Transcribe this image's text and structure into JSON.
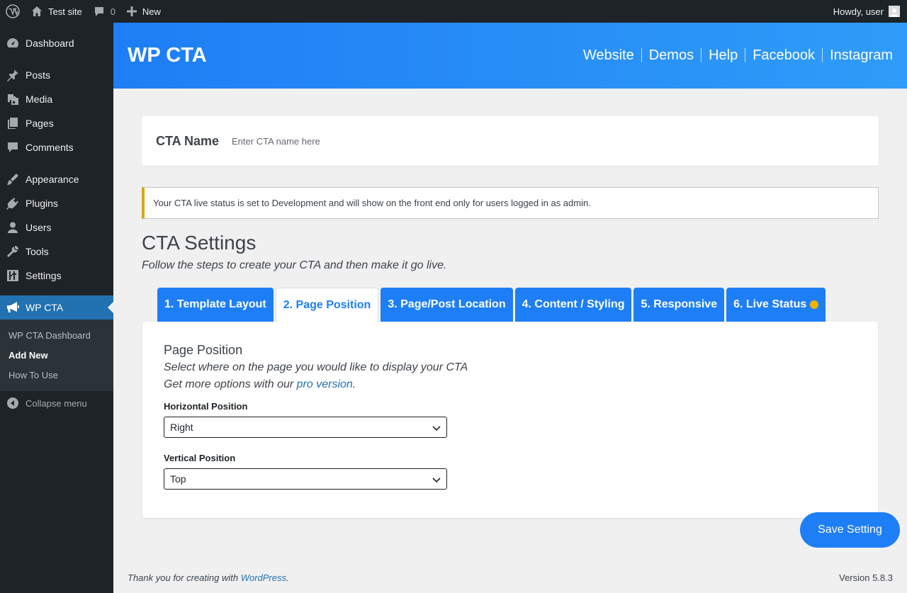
{
  "adminbar": {
    "site_name": "Test site",
    "comments_count": "0",
    "new_label": "New",
    "howdy": "Howdy, user"
  },
  "sidebar": {
    "items": [
      {
        "label": "Dashboard",
        "icon": "dashboard-icon"
      },
      {
        "label": "Posts",
        "icon": "pin-icon"
      },
      {
        "label": "Media",
        "icon": "media-icon"
      },
      {
        "label": "Pages",
        "icon": "pages-icon"
      },
      {
        "label": "Comments",
        "icon": "comment-icon"
      },
      {
        "label": "Appearance",
        "icon": "brush-icon"
      },
      {
        "label": "Plugins",
        "icon": "plug-icon"
      },
      {
        "label": "Users",
        "icon": "user-icon"
      },
      {
        "label": "Tools",
        "icon": "wrench-icon"
      },
      {
        "label": "Settings",
        "icon": "sliders-icon"
      },
      {
        "label": "WP CTA",
        "icon": "megaphone-icon"
      }
    ],
    "submenu": [
      "WP CTA Dashboard",
      "Add New",
      "How To Use"
    ],
    "collapse_label": "Collapse menu"
  },
  "header": {
    "brand": "WP CTA",
    "links": [
      "Website",
      "Demos",
      "Help",
      "Facebook",
      "Instagram"
    ]
  },
  "cta_name": {
    "label": "CTA Name",
    "placeholder": "Enter CTA name here",
    "value": ""
  },
  "notice": {
    "text": "Your CTA live status is set to Development and will show on the front end only for users logged in as admin."
  },
  "settings": {
    "title": "CTA Settings",
    "subtitle": "Follow the steps to create your CTA and then make it go live."
  },
  "tabs": [
    {
      "label": "1. Template Layout",
      "active": false
    },
    {
      "label": "2. Page Position",
      "active": true
    },
    {
      "label": "3. Page/Post Location",
      "active": false
    },
    {
      "label": "4. Content / Styling",
      "active": false
    },
    {
      "label": "5. Responsive",
      "active": false
    },
    {
      "label": "6. Live Status",
      "active": false,
      "status_dot_color": "#f0b400"
    }
  ],
  "panel": {
    "title": "Page Position",
    "description": "Select where on the page you would like to display your CTA",
    "more_prefix": "Get more options with our ",
    "more_link": "pro version",
    "more_suffix": ".",
    "horizontal_label": "Horizontal Position",
    "horizontal_value": "Right",
    "vertical_label": "Vertical Position",
    "vertical_value": "Top"
  },
  "save_label": "Save Setting",
  "footer": {
    "thanks_prefix": "Thank you for creating with ",
    "thanks_link": "WordPress",
    "thanks_suffix": ".",
    "version": "Version 5.8.3"
  },
  "colors": {
    "accent": "#1e7ef5",
    "sidebar_bg": "#1d2327",
    "active_menu": "#2271b1",
    "notice_border": "#dba617"
  }
}
